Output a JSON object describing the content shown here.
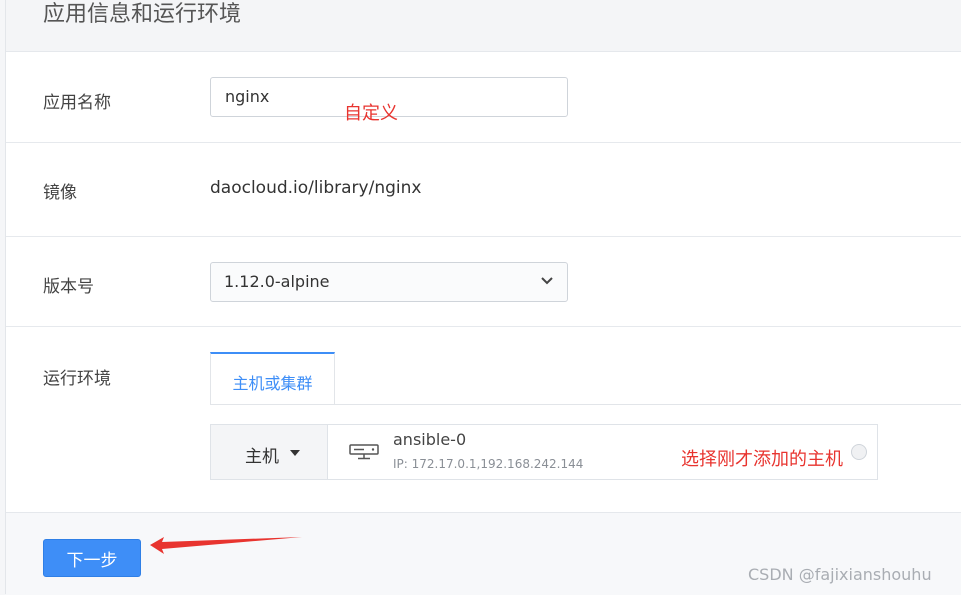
{
  "header": {
    "title": "应用信息和运行环境"
  },
  "form": {
    "app_name": {
      "label": "应用名称",
      "value": "nginx",
      "annotation": "自定义"
    },
    "image": {
      "label": "镜像",
      "value": "daocloud.io/library/nginx"
    },
    "version": {
      "label": "版本号",
      "selected": "1.12.0-alpine"
    },
    "runtime": {
      "label": "运行环境",
      "tab": "主机或集群",
      "host_type": "主机",
      "host": {
        "name": "ansible-0",
        "ip": "IP: 172.17.0.1,192.168.242.144"
      },
      "annotation": "选择刚才添加的主机"
    }
  },
  "footer": {
    "next_label": "下一步"
  },
  "watermark": "CSDN @fajixianshouhu",
  "colors": {
    "accent": "#3e8ef7",
    "annotation": "#e8342f"
  },
  "icons": {
    "server": "server-icon",
    "chevron": "chevron-down-icon",
    "caret": "caret-down-icon"
  }
}
